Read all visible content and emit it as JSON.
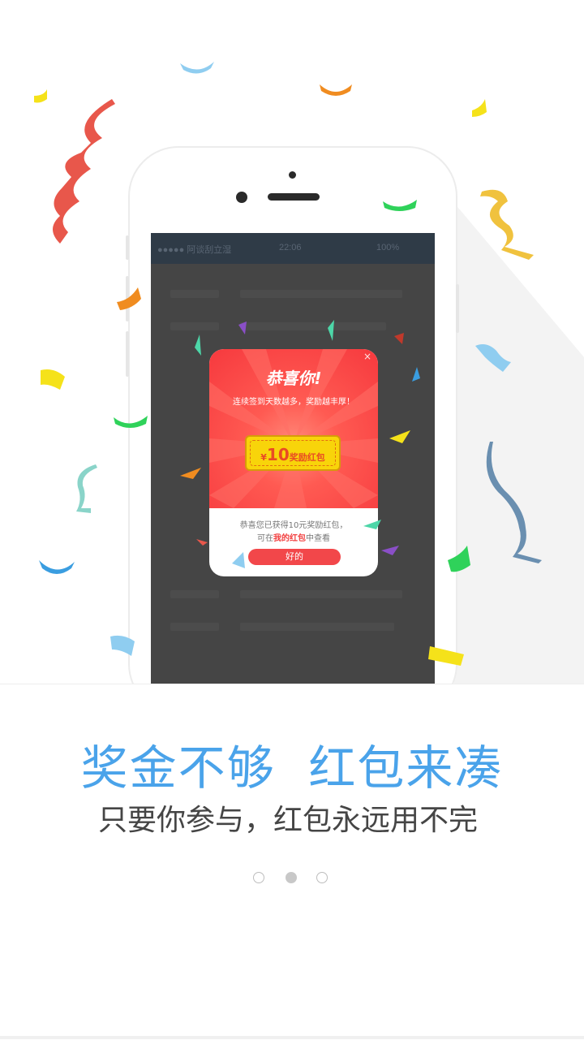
{
  "popup": {
    "title": "恭喜你!",
    "subtitle": "连续签到天数越多，奖励越丰厚！",
    "close_icon": "×",
    "coupon_currency": "¥",
    "coupon_amount": "10",
    "coupon_label": "奖励红包",
    "message_line1": "恭喜您已获得10元奖励红包，",
    "message_line2_prefix": "可在",
    "message_line2_link": "我的红包",
    "message_line2_suffix": "中查看",
    "ok_label": "好的"
  },
  "statusbar": {
    "carrier": "●●●●● 阿谈刮立湿",
    "time": "22:06",
    "battery": "100%"
  },
  "main": {
    "headline": "奖金不够  红包来凑",
    "subline": "只要你参与，红包永远用不完"
  },
  "pager": {
    "total": 3,
    "active_index": 1
  },
  "colors": {
    "headline": "#4aa3ea",
    "popup_red": "#f6393e",
    "coupon_yellow": "#f8d40a",
    "screen_dark": "#454545"
  }
}
